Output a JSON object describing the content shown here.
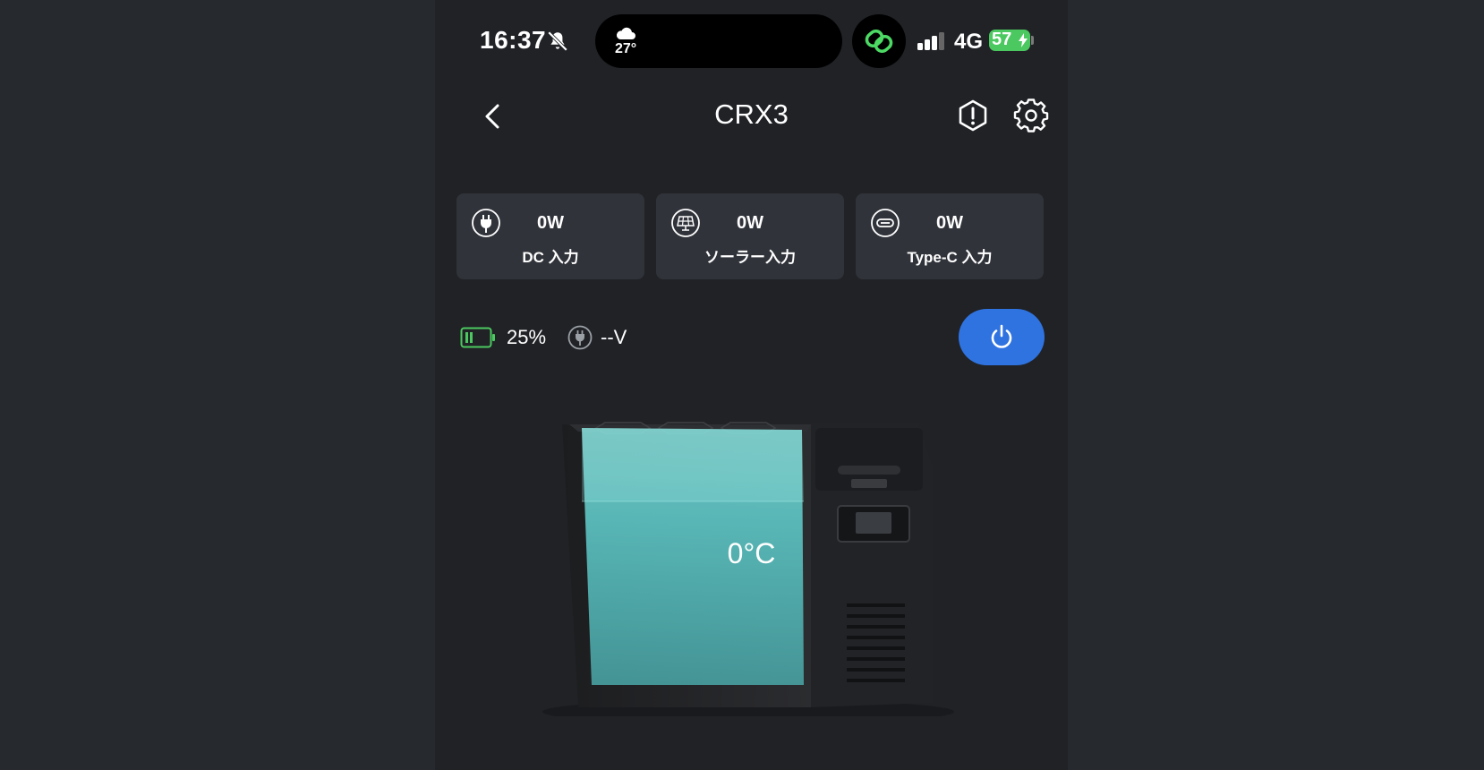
{
  "status_bar": {
    "time": "16:37",
    "weather_temp": "27°",
    "network": "4G",
    "battery_level": "57",
    "icons": [
      "bell-slash-icon",
      "cloud-icon",
      "link-icon",
      "signal-icon",
      "bolt-icon"
    ]
  },
  "nav": {
    "title": "CRX3",
    "icons": [
      "chevron-left-icon",
      "alert-icon",
      "gear-icon"
    ]
  },
  "inputs": [
    {
      "value": "0W",
      "label": "DC 入力",
      "icon": "plug-icon"
    },
    {
      "value": "0W",
      "label": "ソーラー入力",
      "icon": "solar-panel-icon"
    },
    {
      "value": "0W",
      "label": "Type-C 入力",
      "icon": "usb-c-icon"
    }
  ],
  "status": {
    "battery_percent": "25%",
    "voltage": "--V"
  },
  "fridge": {
    "temperature": "0°C"
  },
  "colors": {
    "accent": "#2f73e0",
    "battery_green": "#4cc860",
    "card_bg": "#30333a",
    "screen_bg": "#202226",
    "cool_fill": "#5ec7c6"
  }
}
